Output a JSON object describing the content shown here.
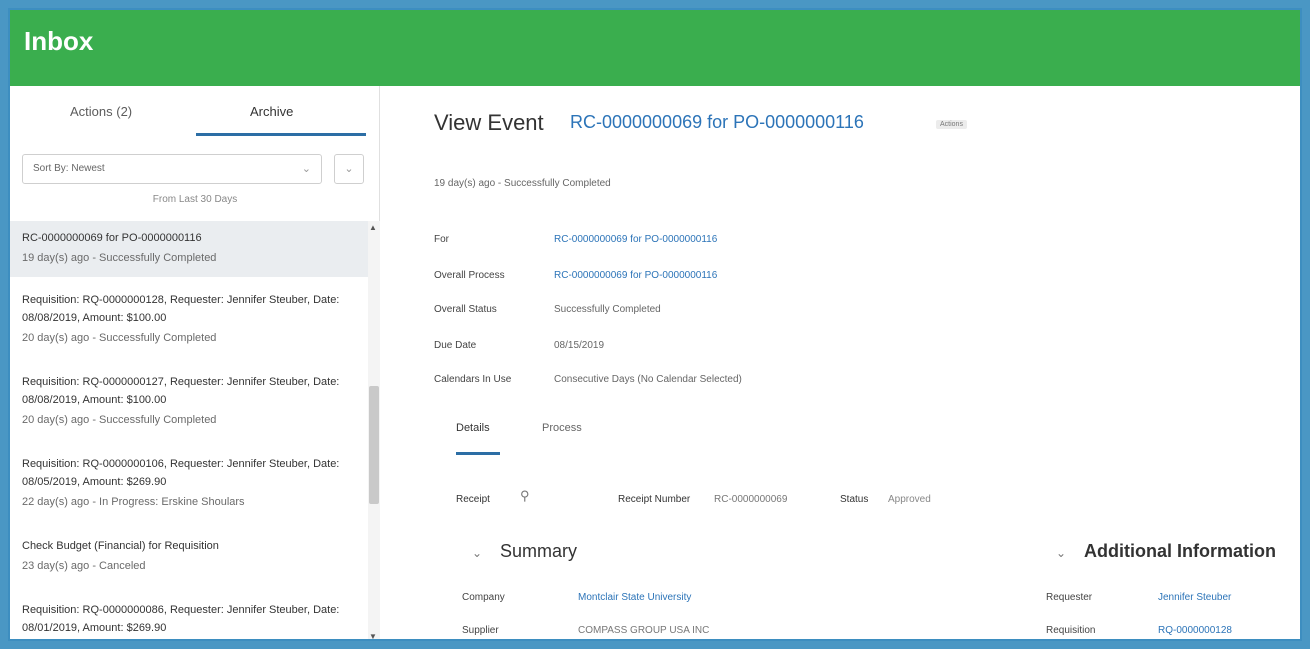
{
  "header": {
    "title": "Inbox"
  },
  "sidebar": {
    "tabs": [
      {
        "label": "Actions (2)"
      },
      {
        "label": "Archive"
      }
    ],
    "sort_label": "Sort By: Newest",
    "sort_chevron": "⌄",
    "extra_chevron": "⌄",
    "from_text": "From Last 30 Days",
    "items": [
      {
        "title": "RC-0000000069 for PO-0000000116",
        "subtitle": "19 day(s) ago - Successfully Completed"
      },
      {
        "title": "Requisition: RQ-0000000128, Requester: Jennifer Steuber, Date: 08/08/2019, Amount: $100.00",
        "subtitle": "20 day(s) ago - Successfully Completed"
      },
      {
        "title": "Requisition: RQ-0000000127, Requester: Jennifer Steuber, Date: 08/08/2019, Amount: $100.00",
        "subtitle": "20 day(s) ago - Successfully Completed"
      },
      {
        "title": "Requisition: RQ-0000000106, Requester: Jennifer Steuber, Date: 08/05/2019, Amount: $269.90",
        "subtitle": "22 day(s) ago - In Progress: Erskine Shoulars"
      },
      {
        "title": "Check Budget (Financial) for Requisition",
        "subtitle": "23 day(s) ago - Canceled"
      },
      {
        "title": "Requisition: RQ-0000000086, Requester: Jennifer Steuber, Date: 08/01/2019, Amount: $269.90",
        "subtitle": ""
      }
    ]
  },
  "main": {
    "view_label": "View Event",
    "view_link": "RC-0000000069 for PO-0000000116",
    "badge": "Actions",
    "ago_line": "19 day(s) ago - Successfully Completed",
    "fields": [
      {
        "label": "For",
        "value": "RC-0000000069 for PO-0000000116"
      },
      {
        "label": "Overall Process",
        "value": "RC-0000000069 for PO-0000000116"
      },
      {
        "label": "Overall Status",
        "value": "Successfully Completed"
      },
      {
        "label": "Due Date",
        "value": "08/15/2019"
      },
      {
        "label": "Calendars In Use",
        "value": "Consecutive Days (No Calendar Selected)"
      }
    ],
    "detail_tabs": [
      {
        "label": "Details"
      },
      {
        "label": "Process"
      }
    ],
    "receipt": {
      "label": "Receipt",
      "number_label": "Receipt Number",
      "number_value": "RC-0000000069",
      "status_label": "Status",
      "status_value": "Approved"
    },
    "summary": {
      "chevron": "⌄",
      "title": "Summary",
      "rows": [
        {
          "label": "Company",
          "value": "Montclair State University"
        },
        {
          "label": "Supplier",
          "value": "COMPASS GROUP USA INC"
        }
      ]
    },
    "additional": {
      "chevron": "⌄",
      "title": "Additional Information",
      "rows": [
        {
          "label": "Requester",
          "value": "Jennifer Steuber"
        },
        {
          "label": "Requisition",
          "value": "RQ-0000000128"
        }
      ]
    }
  },
  "colors": {
    "header": "#3aae4e",
    "link": "#2c74b8",
    "tab_underline": "#2c6ea5",
    "selected_row": "#eaedf0"
  },
  "icons": {
    "search": "search-icon",
    "chevron": "chevron-down-icon",
    "scroll_up": "scroll-up-icon",
    "scroll_down": "scroll-down-icon"
  }
}
